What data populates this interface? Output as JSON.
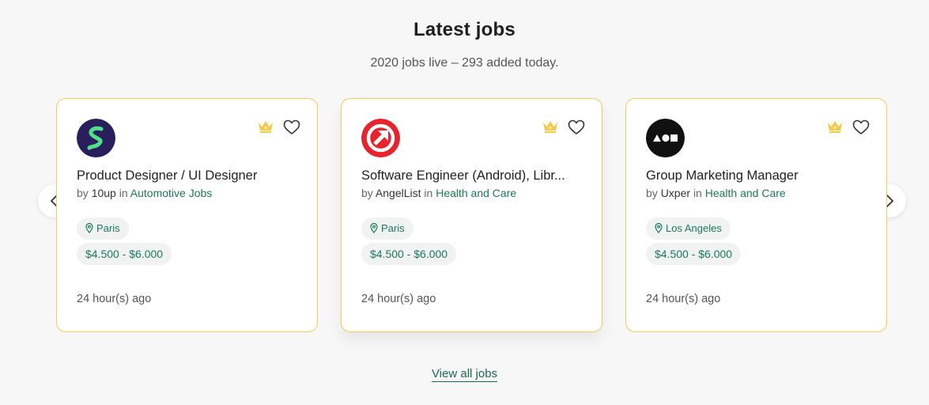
{
  "section": {
    "title": "Latest jobs",
    "subtitle": "2020 jobs live – 293 added today."
  },
  "navigation": {
    "prev_icon": "chevron-left-icon",
    "next_icon": "chevron-right-icon"
  },
  "jobs": [
    {
      "title": "Product Designer / UI Designer",
      "by_label": "by",
      "company": "10up",
      "in_label": "in",
      "category": "Automotive Jobs",
      "location": "Paris",
      "salary": "$4.500 - $6.000",
      "posted": "24 hour(s) ago",
      "logo_icon": "squiggle-logo-icon",
      "logo_colors": {
        "background": "#2a1f5c",
        "mark": "#4fe08a"
      }
    },
    {
      "title": "Software Engineer (Android), Libr...",
      "by_label": "by",
      "company": "AngelList",
      "in_label": "in",
      "category": "Health and Care",
      "location": "Paris",
      "salary": "$4.500 - $6.000",
      "posted": "24 hour(s) ago",
      "logo_icon": "arrow-logo-icon",
      "logo_colors": {
        "background": "#e8232b",
        "mark": "#ffffff"
      }
    },
    {
      "title": "Group Marketing Manager",
      "by_label": "by",
      "company": "Uxper",
      "in_label": "in",
      "category": "Health and Care",
      "location": "Los Angeles",
      "salary": "$4.500 - $6.000",
      "posted": "24 hour(s) ago",
      "logo_icon": "shapes-logo-icon",
      "logo_colors": {
        "background": "#111111",
        "mark": "#ffffff"
      }
    }
  ],
  "icons": {
    "featured": "crown-icon",
    "favorite": "heart-icon",
    "location": "map-pin-icon"
  },
  "colors": {
    "accent_green": "#1b7a55",
    "card_border": "#f1cd53",
    "crown": "#f7c948"
  },
  "footer": {
    "view_all_label": "View all jobs"
  }
}
